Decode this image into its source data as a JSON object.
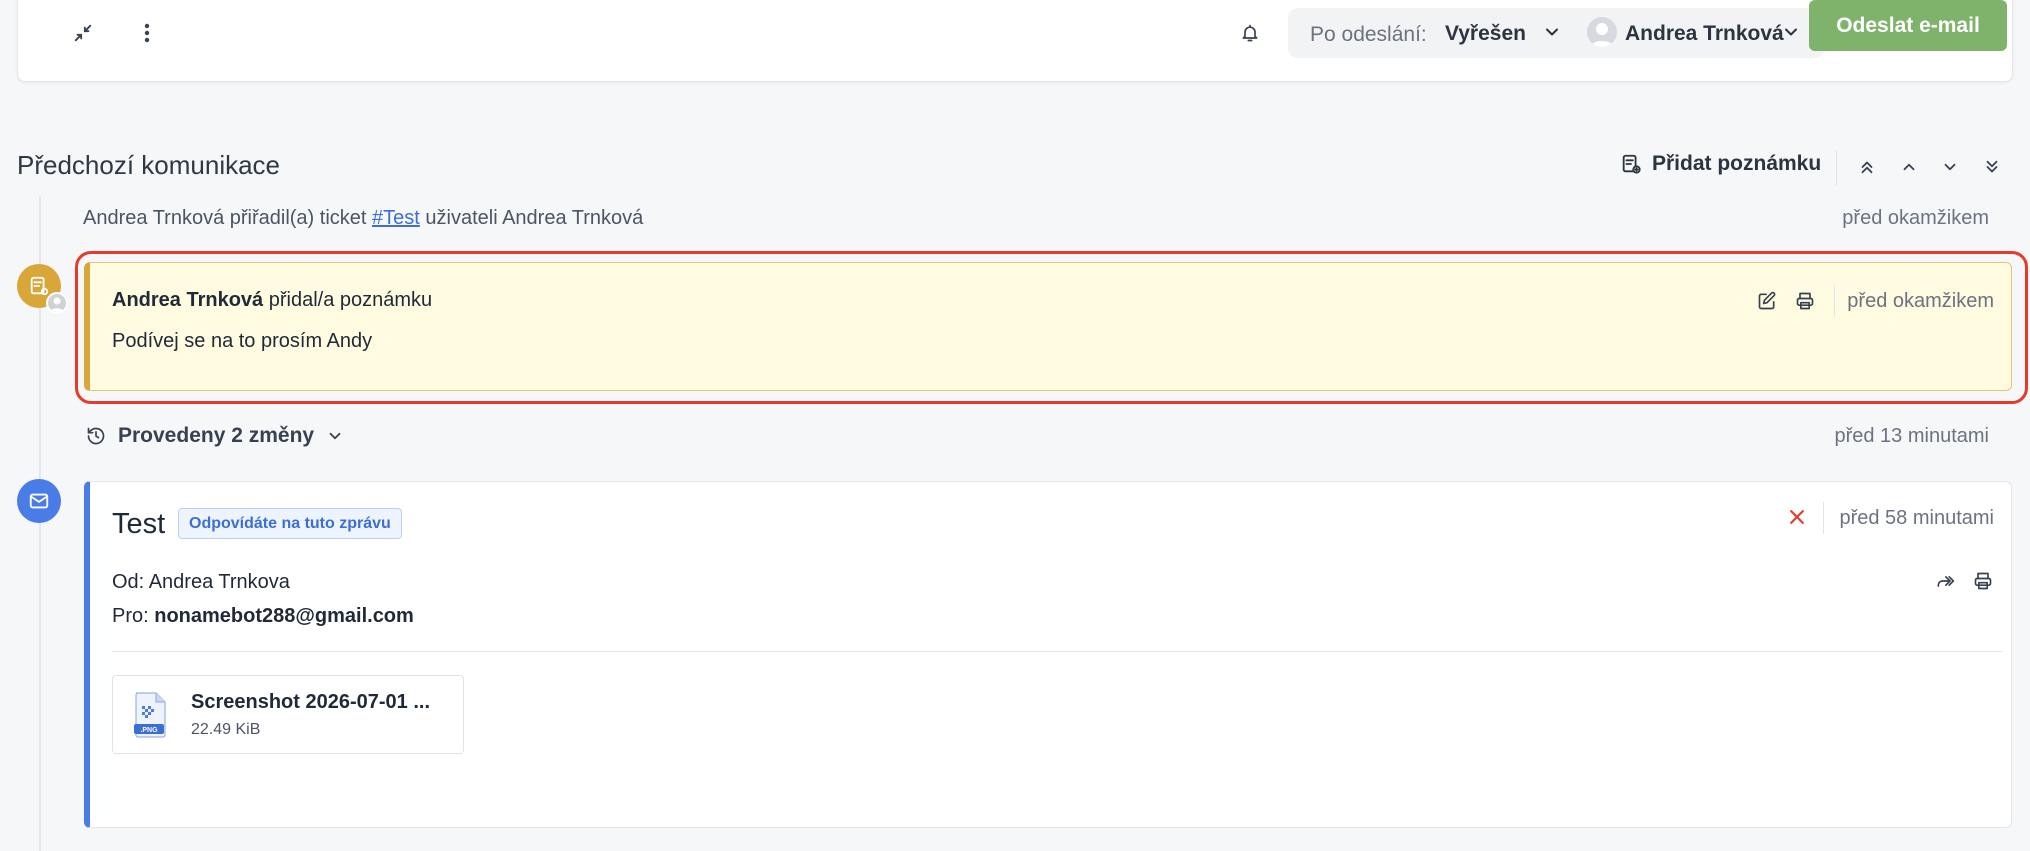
{
  "toolbar": {
    "after_send_label": "Po odeslání:",
    "after_send_value": "Vyřešen",
    "assignee_name": "Andrea Trnková",
    "send_button": "Odeslat e-mail",
    "colors": {
      "send_button_bg": "#7fb36c"
    }
  },
  "section": {
    "title": "Předchozí komunikace",
    "add_note_label": "Přidat poznámku"
  },
  "timeline": {
    "assignment": {
      "prefix": "Andrea Trnková přiřadil(a) ticket ",
      "ticket_link": "#Test",
      "suffix": " uživateli Andrea Trnková",
      "time": "před okamžikem"
    },
    "note": {
      "author": "Andrea Trnková",
      "action": " přidal/a poznámku",
      "text": "Podívej se na to prosím Andy",
      "time": "před okamžikem",
      "colors": {
        "background": "#fffbe0",
        "accent": "#d9a63a",
        "highlight": "#e53b2b"
      }
    },
    "changes": {
      "label": "Provedeny 2 změny",
      "time": "před 13 minutami"
    },
    "email": {
      "subject": "Test",
      "reply_badge": "Odpovídáte na tuto zprávu",
      "time": "před 58 minutami",
      "from_label": "Od:",
      "from_value": "Andrea Trnkova",
      "to_label": "Pro:",
      "to_value": "nonamebot288@gmail.com",
      "attachment": {
        "name": "Screenshot 2026-07-01 ...",
        "size": "22.49 KiB",
        "type_label": ".PNG"
      },
      "colors": {
        "accent": "#4a7ce8",
        "close": "#e53b2b"
      }
    }
  }
}
